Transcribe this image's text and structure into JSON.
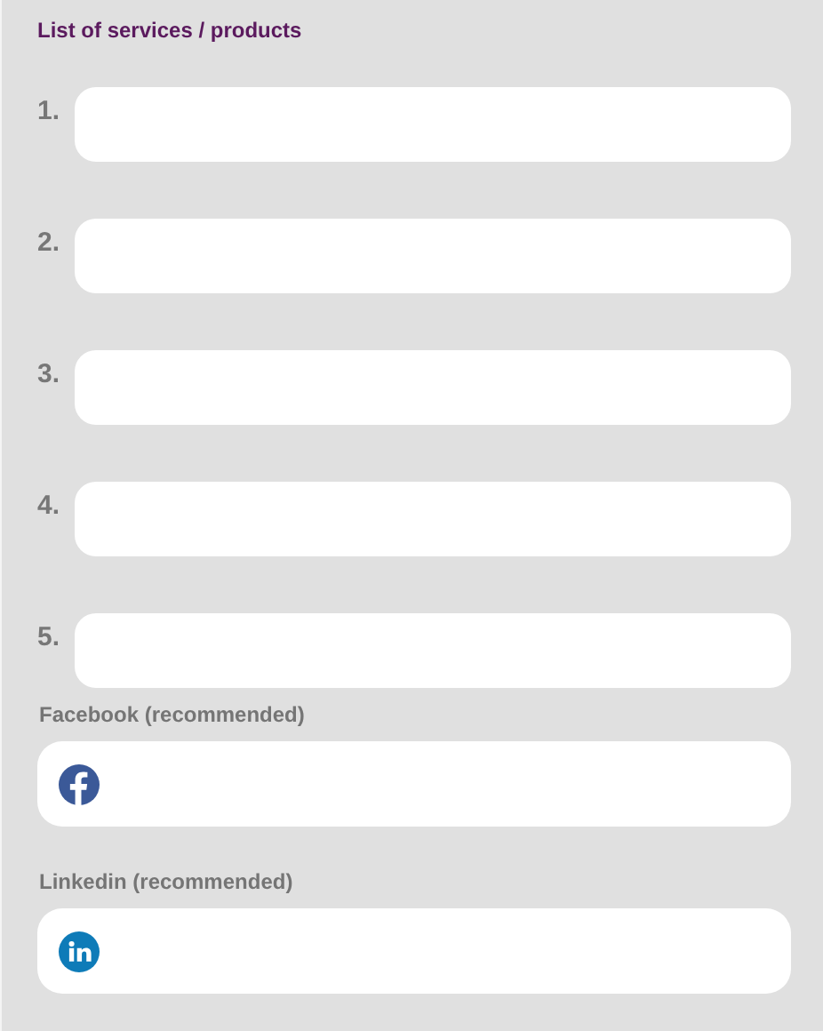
{
  "title": "List of services / products",
  "items": [
    {
      "number": "1."
    },
    {
      "number": "2."
    },
    {
      "number": "3."
    },
    {
      "number": "4."
    },
    {
      "number": "5."
    }
  ],
  "social": [
    {
      "label": "Facebook (recommended)",
      "kind": "facebook"
    },
    {
      "label": "Linkedin (recommended)",
      "kind": "linkedin"
    }
  ]
}
